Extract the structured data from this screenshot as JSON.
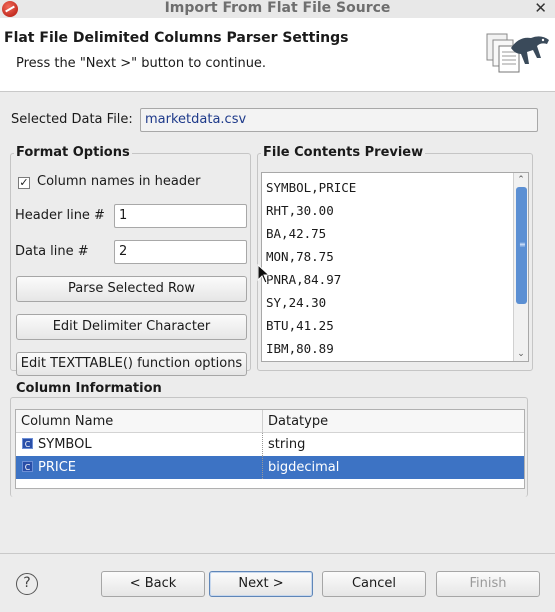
{
  "window": {
    "title": "Import From Flat File Source"
  },
  "banner": {
    "title": "Flat File Delimited Columns Parser Settings",
    "message": "Press the \"Next >\" button to continue."
  },
  "data_file": {
    "label": "Selected Data File:",
    "value": "marketdata.csv"
  },
  "format_options": {
    "title": "Format Options",
    "column_names_label": "Column names in header",
    "column_names_checked": true,
    "header_line_label": "Header line #",
    "header_line_value": "1",
    "data_line_label": "Data line #",
    "data_line_value": "2",
    "parse_button": "Parse Selected Row",
    "delimiter_button": "Edit Delimiter Character",
    "texttable_button": "Edit TEXTTABLE() function options"
  },
  "preview": {
    "title": "File Contents Preview",
    "lines": [
      "SYMBOL,PRICE",
      "RHT,30.00",
      "BA,42.75",
      "MON,78.75",
      "PNRA,84.97",
      "SY,24.30",
      "BTU,41.25",
      "IBM,80.89"
    ]
  },
  "column_info": {
    "title": "Column Information",
    "headers": [
      "Column Name",
      "Datatype"
    ],
    "rows": [
      {
        "name": "SYMBOL",
        "type": "string",
        "icon": "C"
      },
      {
        "name": "PRICE",
        "type": "bigdecimal",
        "icon": "C"
      }
    ],
    "selected_row": 1
  },
  "buttons": {
    "back": "< Back",
    "next": "Next >",
    "cancel": "Cancel",
    "finish": "Finish"
  },
  "colors": {
    "selection": "#3d73c4",
    "scroll_thumb": "#5b8fd3"
  }
}
